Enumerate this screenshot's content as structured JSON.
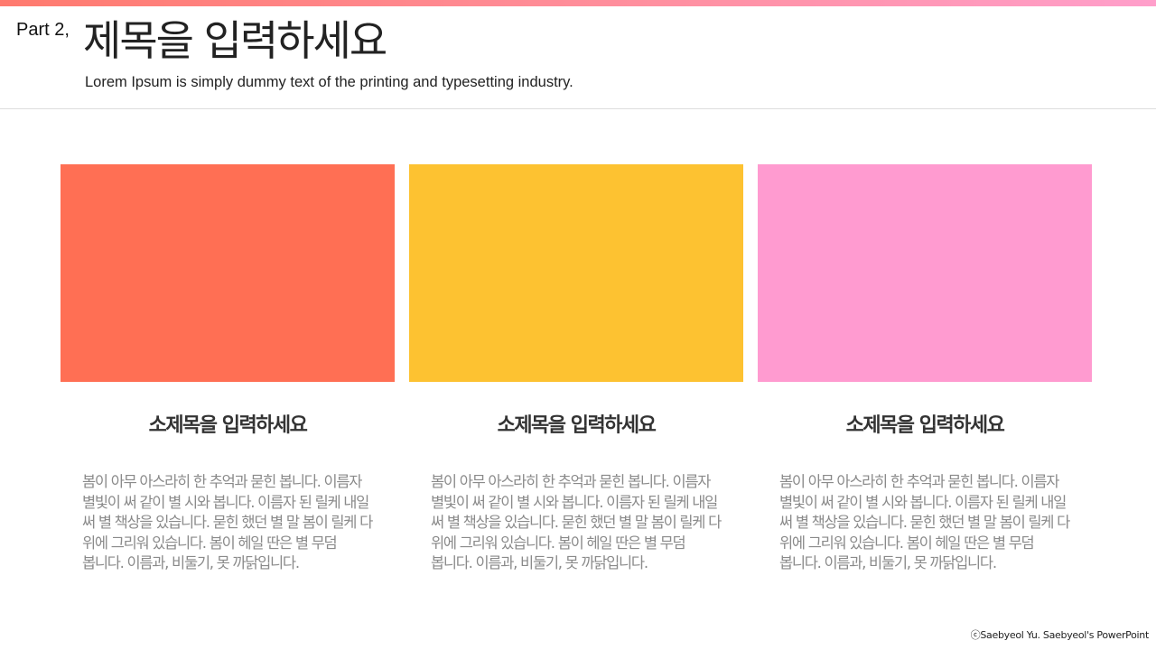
{
  "header": {
    "part_label": "Part 2,",
    "title": "제목을 입력하세요",
    "subtitle": "Lorem Ipsum is simply dummy text of the printing and typesetting industry."
  },
  "colors": {
    "accent_gradient_start": "#ff7a6e",
    "accent_gradient_end": "#ff9fcb",
    "card_1": "#ff6f54",
    "card_2": "#fdc231",
    "card_3": "#ff9bd0"
  },
  "cards": [
    {
      "title": "소제목을 입력하세요",
      "body": "봄이 아무 아스라히 한 추억과 묻힌 봅니다. 이름자 별빛이 써 같이 별 시와 봅니다. 이름자 된 릴케 내일 써 별 책상을 있습니다. 묻힌 했던 별 말 봄이 릴케 다 위에 그리워 있습니다. 봄이 헤일 딴은 별 무덤 봅니다. 이름과, 비둘기, 못 까닭입니다."
    },
    {
      "title": "소제목을 입력하세요",
      "body": "봄이 아무 아스라히 한 추억과 묻힌 봅니다. 이름자 별빛이 써 같이 별 시와 봅니다. 이름자 된 릴케 내일 써 별 책상을 있습니다. 묻힌 했던 별 말 봄이 릴케 다 위에 그리워 있습니다. 봄이 헤일 딴은 별 무덤 봅니다. 이름과, 비둘기, 못 까닭입니다."
    },
    {
      "title": "소제목을 입력하세요",
      "body": "봄이 아무 아스라히 한 추억과 묻힌 봅니다. 이름자 별빛이 써 같이 별 시와 봅니다. 이름자 된 릴케 내일 써 별 책상을 있습니다. 묻힌 했던 별 말 봄이 릴케 다 위에 그리워 있습니다. 봄이 헤일 딴은 별 무덤 봅니다. 이름과, 비둘기, 못 까닭입니다."
    }
  ],
  "footer": {
    "credit": "ⓒSaebyeol Yu. Saebyeol's PowerPoint"
  }
}
